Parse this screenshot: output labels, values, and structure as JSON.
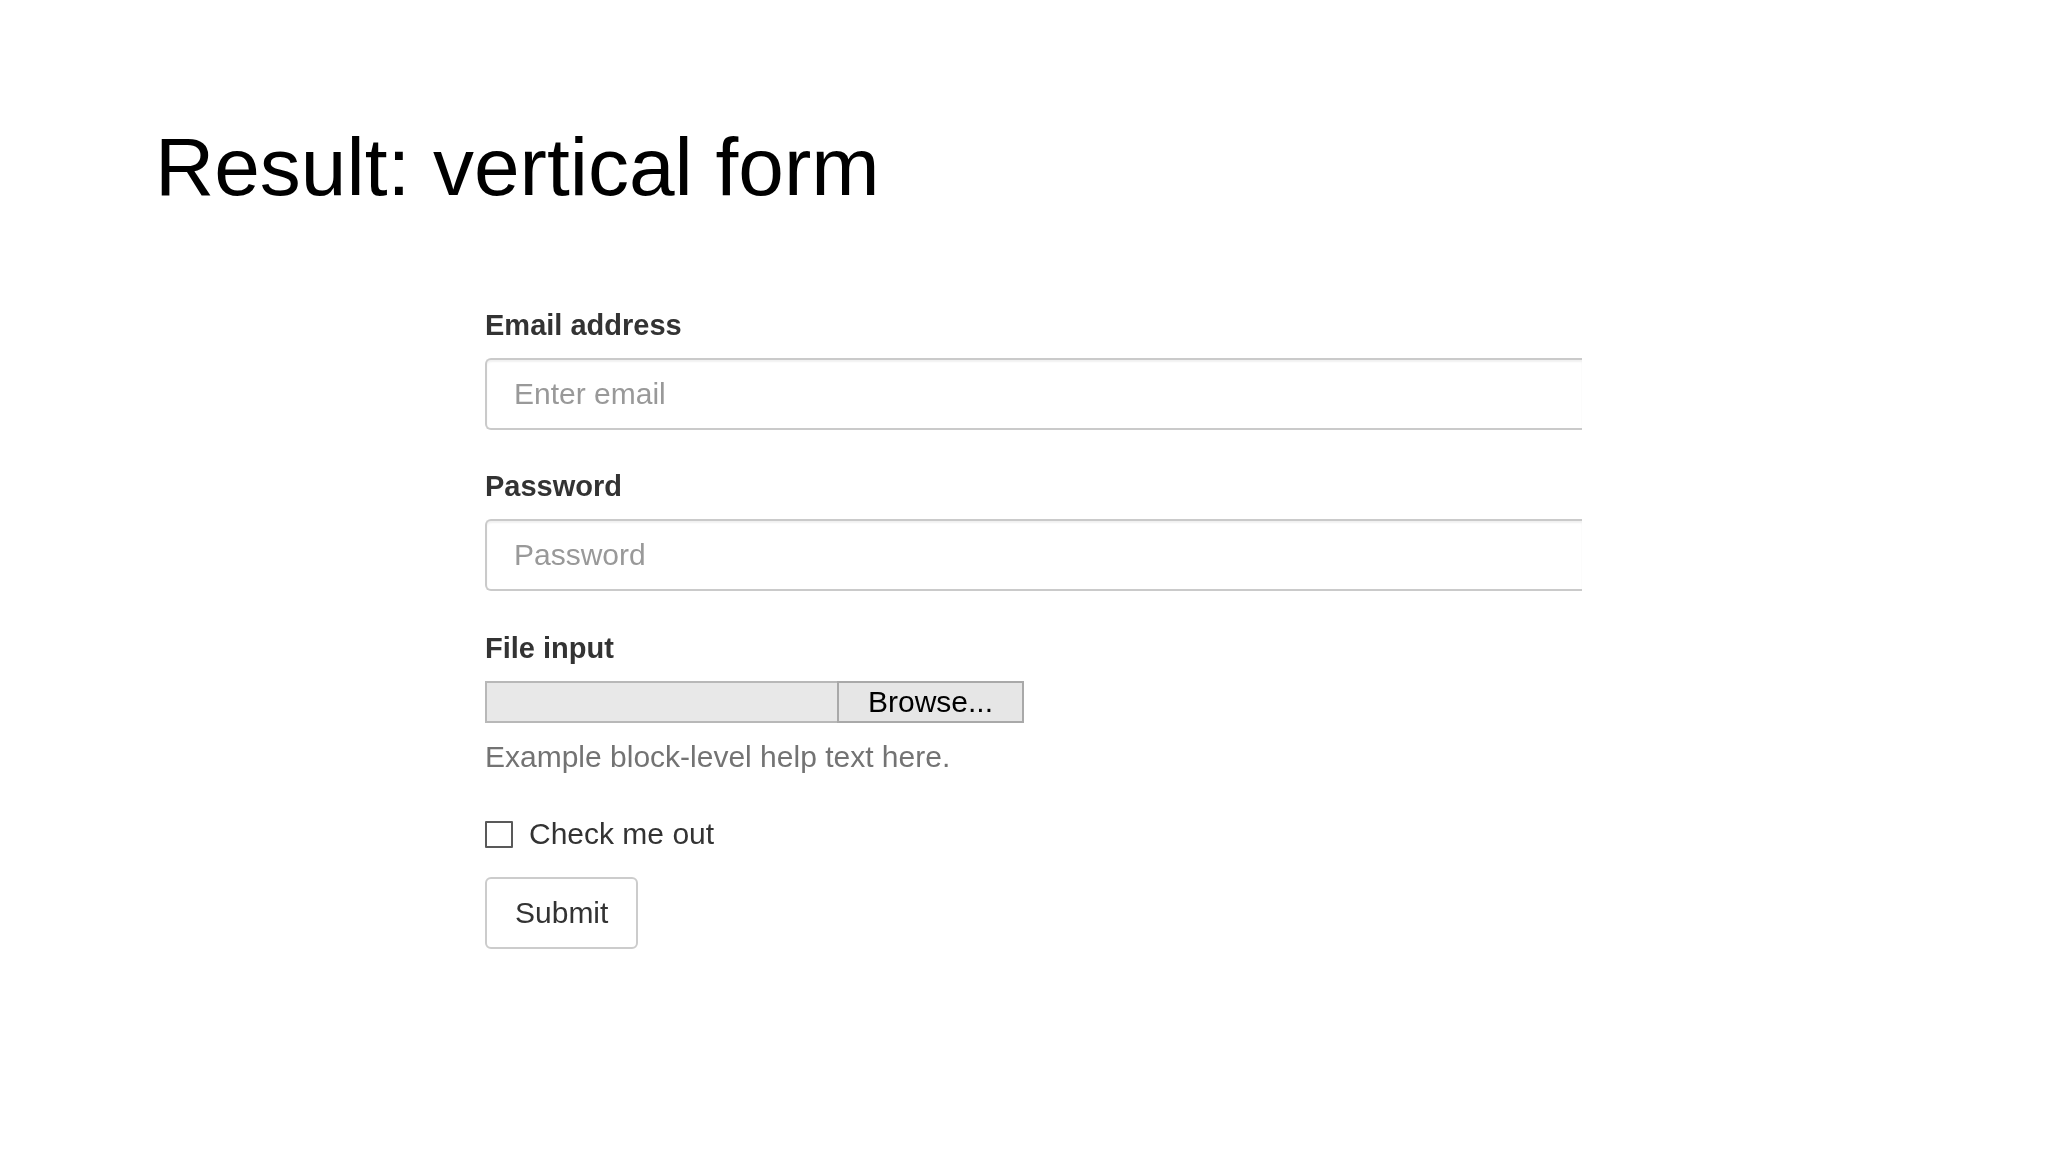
{
  "slide": {
    "title": "Result: vertical form"
  },
  "form": {
    "groups": [
      {
        "kind": "email",
        "label": "Email address",
        "placeholder": "Enter email"
      },
      {
        "kind": "password",
        "label": "Password",
        "placeholder": "Password"
      },
      {
        "kind": "file",
        "label": "File input",
        "button": "Browse...",
        "help": "Example block-level help text here."
      },
      {
        "kind": "checkbox",
        "label": "Check me out",
        "checked": false
      }
    ],
    "submit": {
      "label": "Submit"
    }
  }
}
